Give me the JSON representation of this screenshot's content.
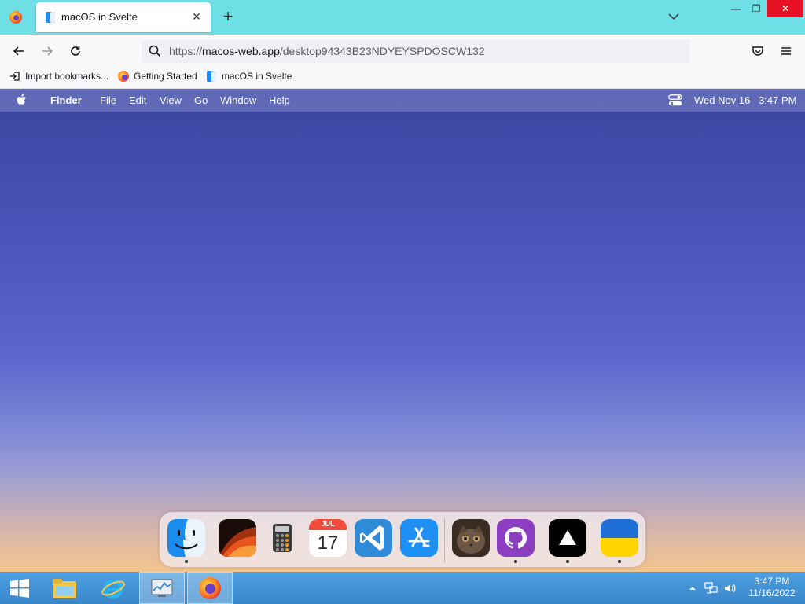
{
  "browser": {
    "tab": {
      "title": "macOS in Svelte"
    },
    "url": {
      "prefix": "https://",
      "domain": "macos-web.app",
      "path": "/desktop94343B23NDYEYSPDOSCW132"
    },
    "window_controls": {
      "minimize": "—",
      "restore": "❐",
      "close": "✕"
    },
    "icons": {
      "menu": "firefox-icon",
      "tab_favicon": "finder-tab-icon",
      "close_tab": "close-icon",
      "new_tab": "plus-icon",
      "list_tabs": "chevron-down-icon",
      "back": "arrow-left-icon",
      "forward": "arrow-right-icon",
      "reload": "reload-icon",
      "search": "search-icon",
      "pocket": "pocket-icon",
      "app_menu": "hamburger-icon"
    },
    "bookmarks": [
      {
        "label": "Import bookmarks...",
        "icon": "import-icon"
      },
      {
        "label": "Getting Started",
        "icon": "firefox-icon"
      },
      {
        "label": "macOS in Svelte",
        "icon": "finder-icon"
      }
    ]
  },
  "macos": {
    "menubar": {
      "app_name": "Finder",
      "items": [
        "File",
        "Edit",
        "View",
        "Go",
        "Window",
        "Help"
      ],
      "date": "Wed Nov 16",
      "time": "3:47 PM"
    },
    "dock": {
      "apps": [
        {
          "name": "Finder",
          "icon": "finder-icon",
          "running": true
        },
        {
          "name": "Wallpapers",
          "icon": "wallpaper-icon",
          "running": false
        },
        {
          "name": "Calculator",
          "icon": "calculator-icon",
          "running": false
        },
        {
          "name": "Calendar",
          "icon": "calendar-icon",
          "running": false,
          "month": "JUL",
          "day": "17"
        },
        {
          "name": "VS Code",
          "icon": "vscode-icon",
          "running": false
        },
        {
          "name": "App Store",
          "icon": "app-store-icon",
          "running": false
        },
        {
          "name": "Purus Twitter",
          "icon": "cat-photo-icon",
          "running": false
        },
        {
          "name": "GitHub",
          "icon": "github-icon",
          "running": true
        },
        {
          "name": "Vercel",
          "icon": "vercel-icon",
          "running": true
        },
        {
          "name": "Ukraine",
          "icon": "ukraine-flag-icon",
          "running": true
        }
      ]
    }
  },
  "taskbar": {
    "items": [
      "start-icon",
      "file-explorer-icon",
      "internet-explorer-icon",
      "task-manager-icon",
      "firefox-icon"
    ],
    "tray": {
      "time": "3:47 PM",
      "date": "11/16/2022"
    }
  },
  "colors": {
    "tabstrip": "#6fdfe6",
    "taskbar": "#3a86c9",
    "close_button": "#e81123"
  }
}
